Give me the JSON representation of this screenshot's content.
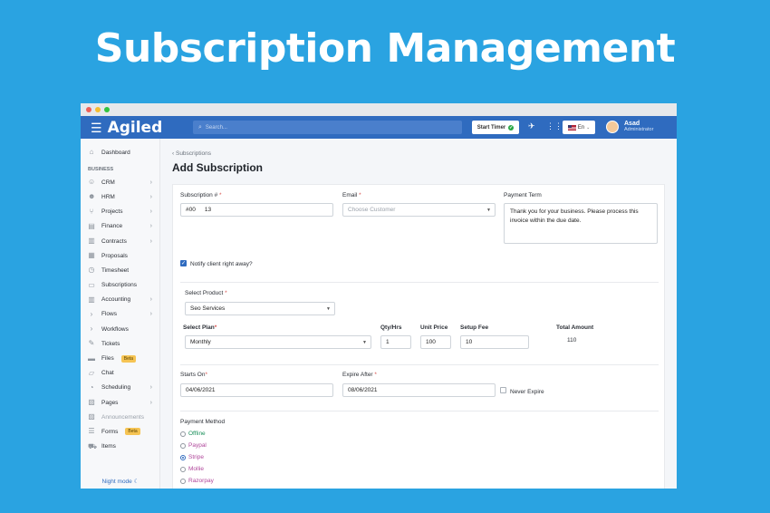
{
  "hero": {
    "title": "Subscription Management"
  },
  "colors": {
    "background": "#2aa3e1",
    "topbar": "#2f6bbf",
    "accent": "#2f6bbf",
    "beta": "#f6c453"
  },
  "topbar": {
    "brand": "Agiled",
    "search_placeholder": "Search...",
    "start_timer": "Start Timer",
    "language": "En",
    "user_name": "Asad",
    "user_role": "Administrator"
  },
  "sidebar": {
    "dashboard": "Dashboard",
    "section": "BUSINESS",
    "items": [
      {
        "label": "CRM",
        "icon": "user-icon",
        "chev": true
      },
      {
        "label": "HRM",
        "icon": "people-icon",
        "chev": true
      },
      {
        "label": "Projects",
        "icon": "project-icon",
        "chev": true
      },
      {
        "label": "Finance",
        "icon": "finance-icon",
        "chev": true
      },
      {
        "label": "Contracts",
        "icon": "contract-icon",
        "chev": true
      },
      {
        "label": "Proposals",
        "icon": "proposal-icon",
        "chev": false
      },
      {
        "label": "Timesheet",
        "icon": "clock-icon",
        "chev": false
      },
      {
        "label": "Subscriptions",
        "icon": "subscription-icon",
        "chev": false
      },
      {
        "label": "Accounting",
        "icon": "chart-icon",
        "chev": true
      },
      {
        "label": "Flows",
        "icon": "flow-icon",
        "chev": true
      },
      {
        "label": "Workflows",
        "icon": "workflow-icon",
        "chev": false
      },
      {
        "label": "Tickets",
        "icon": "wrench-icon",
        "chev": false
      },
      {
        "label": "Files",
        "icon": "folder-icon",
        "chev": false,
        "badge": "Beta"
      },
      {
        "label": "Chat",
        "icon": "chat-icon",
        "chev": false
      },
      {
        "label": "Scheduling",
        "icon": "schedule-icon",
        "chev": true
      },
      {
        "label": "Pages",
        "icon": "page-icon",
        "chev": true
      },
      {
        "label": "Announcements",
        "icon": "announcement-icon",
        "chev": false,
        "muted": true
      },
      {
        "label": "Forms",
        "icon": "form-icon",
        "chev": false,
        "badge": "Beta"
      },
      {
        "label": "Items",
        "icon": "cart-icon",
        "chev": false
      }
    ],
    "night_mode": "Night mode"
  },
  "page": {
    "breadcrumb": "Subscriptions",
    "title": "Add Subscription"
  },
  "form": {
    "subscription_label": "Subscription #",
    "subscription_prefix": "#00",
    "subscription_value": "13",
    "email_label": "Email",
    "email_placeholder": "Choose Customer",
    "payment_term_label": "Payment Term",
    "payment_term_value": "Thank you for your business. Please process this invoice within the due date.",
    "notify_label": "Notify client right away?",
    "notify_checked": true,
    "product_label": "Select Product",
    "product_value": "Seo Services",
    "plan_label": "Select Plan",
    "plan_value": "Monthly",
    "qty_label": "Qty/Hrs",
    "qty_value": "1",
    "unit_price_label": "Unit Price",
    "unit_price_value": "100",
    "setup_fee_label": "Setup Fee",
    "setup_fee_value": "10",
    "total_label": "Total Amount",
    "total_value": "110",
    "starts_label": "Starts On",
    "starts_value": "04/06/2021",
    "expire_label": "Expire After",
    "expire_value": "08/06/2021",
    "never_expire_label": "Never Expire",
    "payment_method_label": "Payment Method",
    "payment_methods": [
      {
        "label": "Offline",
        "color": "#1a8f5a",
        "selected": false
      },
      {
        "label": "Paypal",
        "color": "#b0479b",
        "selected": false
      },
      {
        "label": "Stripe",
        "color": "#b0479b",
        "selected": true
      },
      {
        "label": "Mollie",
        "color": "#b0479b",
        "selected": false
      },
      {
        "label": "Razorpay",
        "color": "#b0479b",
        "selected": false
      }
    ]
  }
}
